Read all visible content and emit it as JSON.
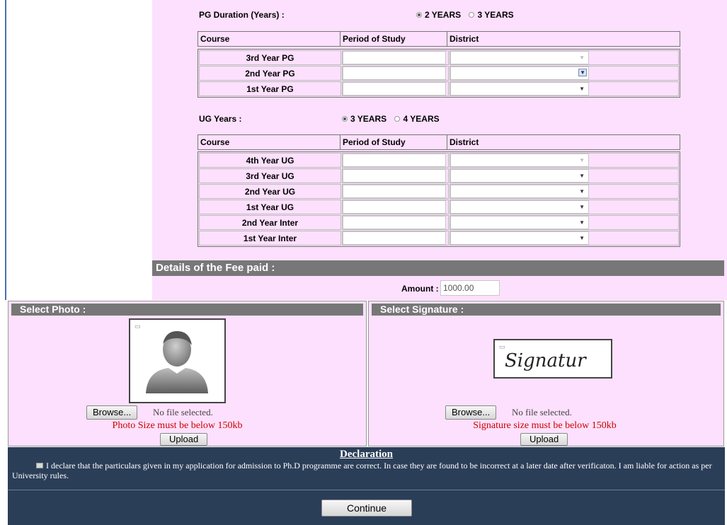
{
  "pg": {
    "label": "PG Duration (Years) :",
    "options": [
      "2 YEARS",
      "3 YEARS"
    ],
    "selected": "2 YEARS",
    "headers": [
      "Course",
      "Period of Study",
      "District"
    ],
    "rows": [
      {
        "course": "3rd Year PG",
        "period": "",
        "district": "",
        "district_disabled": true
      },
      {
        "course": "2nd Year PG",
        "period": "",
        "district": "",
        "district_focused": true
      },
      {
        "course": "1st Year PG",
        "period": "",
        "district": ""
      }
    ]
  },
  "ug": {
    "label": "UG Years :",
    "options": [
      "3 YEARS",
      "4 YEARS"
    ],
    "selected": "3 YEARS",
    "headers": [
      "Course",
      "Period of Study",
      "District"
    ],
    "rows": [
      {
        "course": "4th Year UG",
        "period": "",
        "district": "",
        "district_disabled": true
      },
      {
        "course": "3rd Year UG",
        "period": "",
        "district": ""
      },
      {
        "course": "2nd Year UG",
        "period": "",
        "district": ""
      },
      {
        "course": "1st Year UG",
        "period": "",
        "district": ""
      },
      {
        "course": "2nd Year Inter",
        "period": "",
        "district": ""
      },
      {
        "course": "1st Year Inter",
        "period": "",
        "district": ""
      }
    ]
  },
  "fee": {
    "header": "Details of the Fee paid :",
    "amount_label": "Amount :",
    "amount_value": "1000.00"
  },
  "photo": {
    "header": "Select Photo :",
    "browse_label": "Browse...",
    "file_status": "No file selected.",
    "size_note": "Photo Size must be below 150kb",
    "upload_label": "Upload"
  },
  "signature": {
    "header": "Select Signature :",
    "preview_text": "Signatur",
    "browse_label": "Browse...",
    "file_status": "No file selected.",
    "size_note": "Signature size must be below 150kb",
    "upload_label": "Upload"
  },
  "declaration": {
    "title": "Declaration",
    "text": "I declare that the particulars given in my application for admission to Ph.D programme are correct. In case they are found to be incorrect at a later date after verificaton. I am liable for action as per University rules.",
    "continue_label": "Continue"
  },
  "colors": {
    "panel_bg": "#fde0fd",
    "section_bar": "#777777",
    "declaration_bg": "#2b3e58",
    "warning_text": "#cc0000"
  },
  "icons": {
    "broken_image": "broken-image-icon",
    "avatar": "user-avatar-placeholder-icon",
    "dropdown": "chevron-down-icon"
  }
}
